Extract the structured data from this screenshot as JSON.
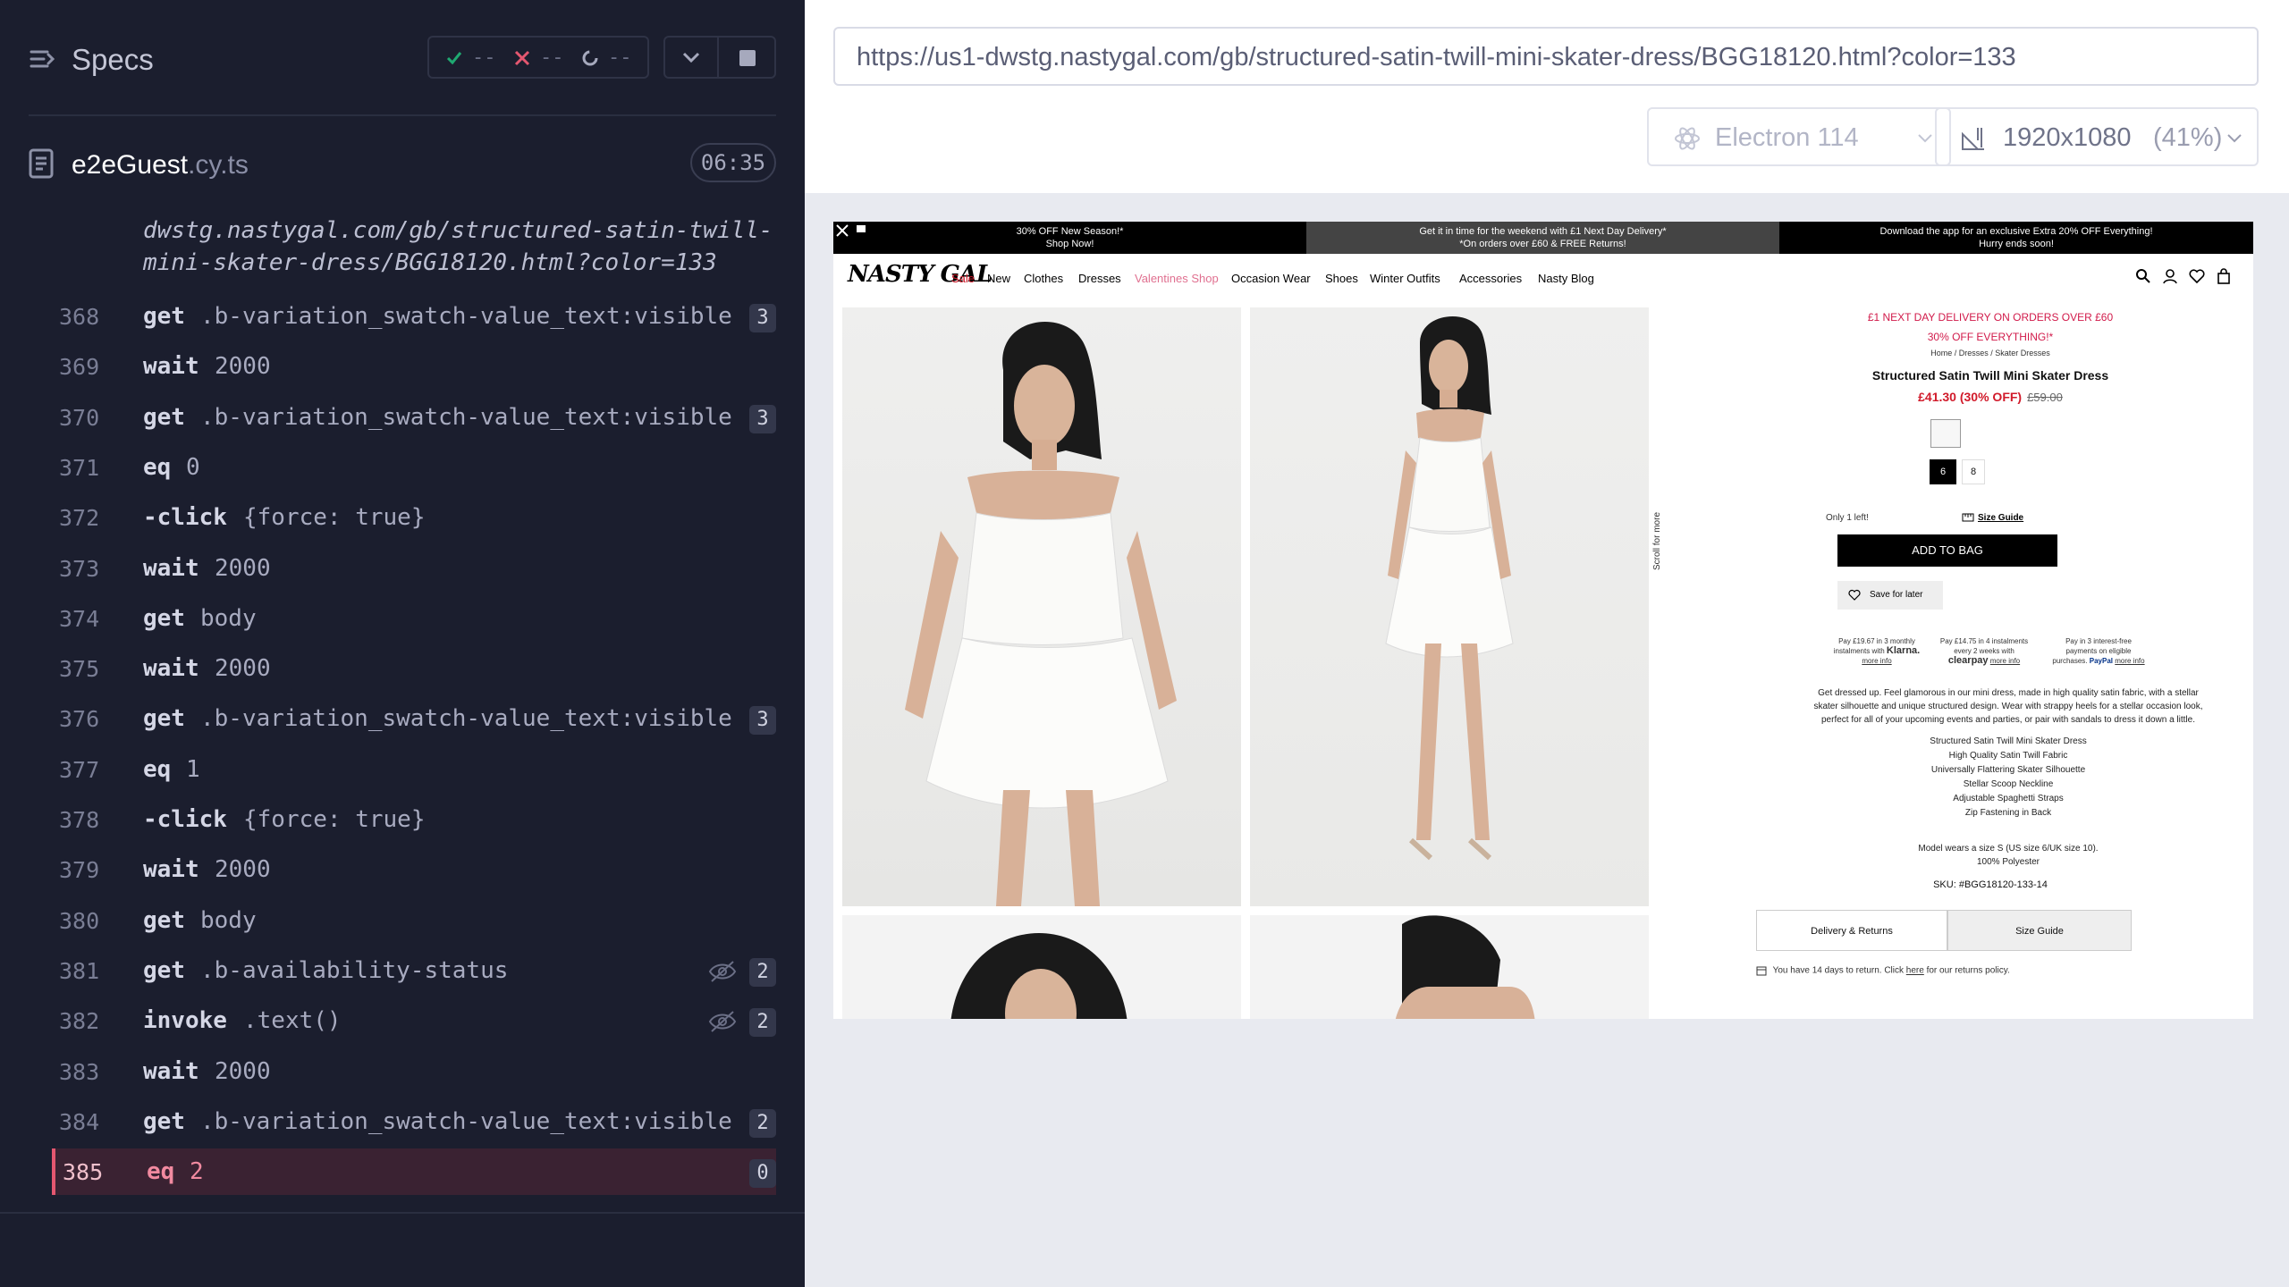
{
  "runner": {
    "specs_title": "Specs",
    "stats": {
      "passed": "--",
      "failed": "--",
      "pending": "--"
    },
    "spec": {
      "name": "e2eGuest",
      "ext": ".cy.ts",
      "duration": "06:35"
    },
    "continuation": [
      "dwstg.nastygal.com/gb/structured-satin-twill-",
      "mini-skater-dress/BGG18120.html?color=133"
    ],
    "commands": [
      {
        "line": "368",
        "name": "get",
        "message": ".b-variation_swatch-value_text:visible",
        "badge": "3",
        "hidden": false,
        "active": false
      },
      {
        "line": "369",
        "name": "wait",
        "message": "2000",
        "badge": "",
        "hidden": false,
        "active": false
      },
      {
        "line": "370",
        "name": "get",
        "message": ".b-variation_swatch-value_text:visible",
        "badge": "3",
        "hidden": false,
        "active": false
      },
      {
        "line": "371",
        "name": "eq",
        "message": "0",
        "badge": "",
        "hidden": false,
        "active": false
      },
      {
        "line": "372",
        "name": "-click",
        "message": "{force: true}",
        "badge": "",
        "hidden": false,
        "active": false
      },
      {
        "line": "373",
        "name": "wait",
        "message": "2000",
        "badge": "",
        "hidden": false,
        "active": false
      },
      {
        "line": "374",
        "name": "get",
        "message": "body",
        "badge": "",
        "hidden": false,
        "active": false
      },
      {
        "line": "375",
        "name": "wait",
        "message": "2000",
        "badge": "",
        "hidden": false,
        "active": false
      },
      {
        "line": "376",
        "name": "get",
        "message": ".b-variation_swatch-value_text:visible",
        "badge": "3",
        "hidden": false,
        "active": false
      },
      {
        "line": "377",
        "name": "eq",
        "message": "1",
        "badge": "",
        "hidden": false,
        "active": false
      },
      {
        "line": "378",
        "name": "-click",
        "message": "{force: true}",
        "badge": "",
        "hidden": false,
        "active": false
      },
      {
        "line": "379",
        "name": "wait",
        "message": "2000",
        "badge": "",
        "hidden": false,
        "active": false
      },
      {
        "line": "380",
        "name": "get",
        "message": "body",
        "badge": "",
        "hidden": false,
        "active": false
      },
      {
        "line": "381",
        "name": "get",
        "message": ".b-availability-status",
        "badge": "2",
        "hidden": true,
        "active": false
      },
      {
        "line": "382",
        "name": "invoke",
        "message": ".text()",
        "badge": "2",
        "hidden": true,
        "active": false
      },
      {
        "line": "383",
        "name": "wait",
        "message": "2000",
        "badge": "",
        "hidden": false,
        "active": false
      },
      {
        "line": "384",
        "name": "get",
        "message": ".b-variation_swatch-value_text:visible",
        "badge": "2",
        "hidden": false,
        "active": false
      },
      {
        "line": "385",
        "name": "eq",
        "message": "2",
        "badge": "0",
        "hidden": false,
        "active": true
      }
    ]
  },
  "browser": {
    "url": "https://us1-dwstg.nastygal.com/gb/structured-satin-twill-mini-skater-dress/BGG18120.html?color=133",
    "browser_name": "Electron 114",
    "viewport": "1920x1080",
    "scale": "(41%)"
  },
  "site": {
    "promo": [
      [
        "30% OFF New Season!*",
        "Shop Now!"
      ],
      [
        "Get it in time for the weekend with £1 Next Day Delivery*",
        "*On orders over £60 & FREE Returns!"
      ],
      [
        "Download the app for an exclusive Extra 20% OFF Everything!",
        "Hurry ends soon!"
      ]
    ],
    "logo": "NASTY GAL",
    "nav": [
      "Sale",
      "New",
      "Clothes",
      "Dresses",
      "Valentines Shop",
      "Occasion Wear",
      "Shoes",
      "Winter Outfits",
      "Accessories",
      "Nasty Blog"
    ],
    "scroll_more": "Scroll for more",
    "delivery_line1": "£1 NEXT DAY DELIVERY ON ORDERS OVER £60",
    "delivery_line2": "30% OFF EVERYTHING!*",
    "breadcrumb": "Home /  Dresses /  Skater Dresses",
    "title": "Structured Satin Twill Mini Skater Dress",
    "price": "£41.30 (30% OFF)",
    "old_price": "£59.00",
    "sizes": [
      "6",
      "8"
    ],
    "only_left": "Only 1 left!",
    "size_guide": "Size Guide",
    "add_to_bag": "ADD TO BAG",
    "save_for_later": "Save for later",
    "pay": {
      "klarna": [
        "Pay £19.67 in 3 monthly",
        "instalments with",
        "Klarna.",
        "more info"
      ],
      "clearpay": [
        "Pay £14.75 in 4 instalments",
        "every 2 weeks with",
        "clearpay",
        "more info"
      ],
      "paypal": [
        "Pay in 3 interest-free",
        "payments on eligible",
        "purchases.",
        "PayPal",
        "more info"
      ]
    },
    "description": "Get dressed up. Feel glamorous in our mini dress, made in high quality satin fabric, with a stellar skater silhouette and unique structured design. Wear with strappy heels for a stellar occasion look, perfect for all of your upcoming events and parties, or pair with sandals to dress it down a little.",
    "features": [
      "Structured Satin Twill Mini Skater Dress",
      "High Quality Satin Twill Fabric",
      "Universally Flattering Skater Silhouette",
      "Stellar Scoop Neckline",
      "Adjustable Spaghetti Straps",
      "Zip Fastening in Back"
    ],
    "model_info": "Model wears a size S (US size 6/UK size 10).",
    "material": "100% Polyester",
    "sku": "SKU: #BGG18120-133-14",
    "tab_delivery": "Delivery & Returns",
    "tab_size": "Size Guide",
    "returns": "You have 14 days to return. Click",
    "returns_here": "here",
    "returns_end": "for our returns policy."
  },
  "colors": {
    "runner_bg": "#1b1e2e",
    "active_red": "#e45770",
    "pass_green": "#1fa971",
    "fail_red": "#e45770"
  }
}
